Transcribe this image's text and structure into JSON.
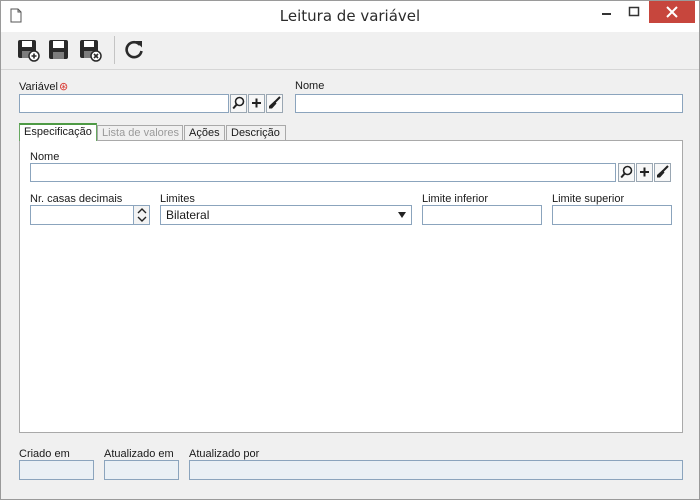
{
  "window": {
    "title": "Leitura de variável",
    "accent": "#c7463d"
  },
  "toolbar": {
    "buttons": [
      {
        "name": "save-new",
        "icon": "save-plus-icon"
      },
      {
        "name": "save",
        "icon": "save-icon"
      },
      {
        "name": "save-close",
        "icon": "save-close-icon"
      },
      {
        "name": "refresh",
        "icon": "refresh-icon"
      }
    ]
  },
  "header": {
    "variavel_label": "Variável",
    "required_mark": "⊛",
    "variavel_value": "",
    "nome_label": "Nome",
    "nome_value": ""
  },
  "tabs": [
    {
      "label": "Especificação",
      "active": true,
      "enabled": true
    },
    {
      "label": "Lista de valores",
      "active": false,
      "enabled": false
    },
    {
      "label": "Ações",
      "active": false,
      "enabled": true
    },
    {
      "label": "Descrição",
      "active": false,
      "enabled": true
    }
  ],
  "spec": {
    "nome_label": "Nome",
    "nome_value": "",
    "decimais_label": "Nr. casas decimais",
    "decimais_value": "",
    "limites_label": "Limites",
    "limites_value": "Bilateral",
    "limite_inferior_label": "Limite inferior",
    "limite_inferior_value": "",
    "limite_superior_label": "Limite superior",
    "limite_superior_value": ""
  },
  "footer": {
    "criado_em_label": "Criado em",
    "criado_em_value": "",
    "atualizado_em_label": "Atualizado em",
    "atualizado_em_value": "",
    "atualizado_por_label": "Atualizado por",
    "atualizado_por_value": ""
  }
}
